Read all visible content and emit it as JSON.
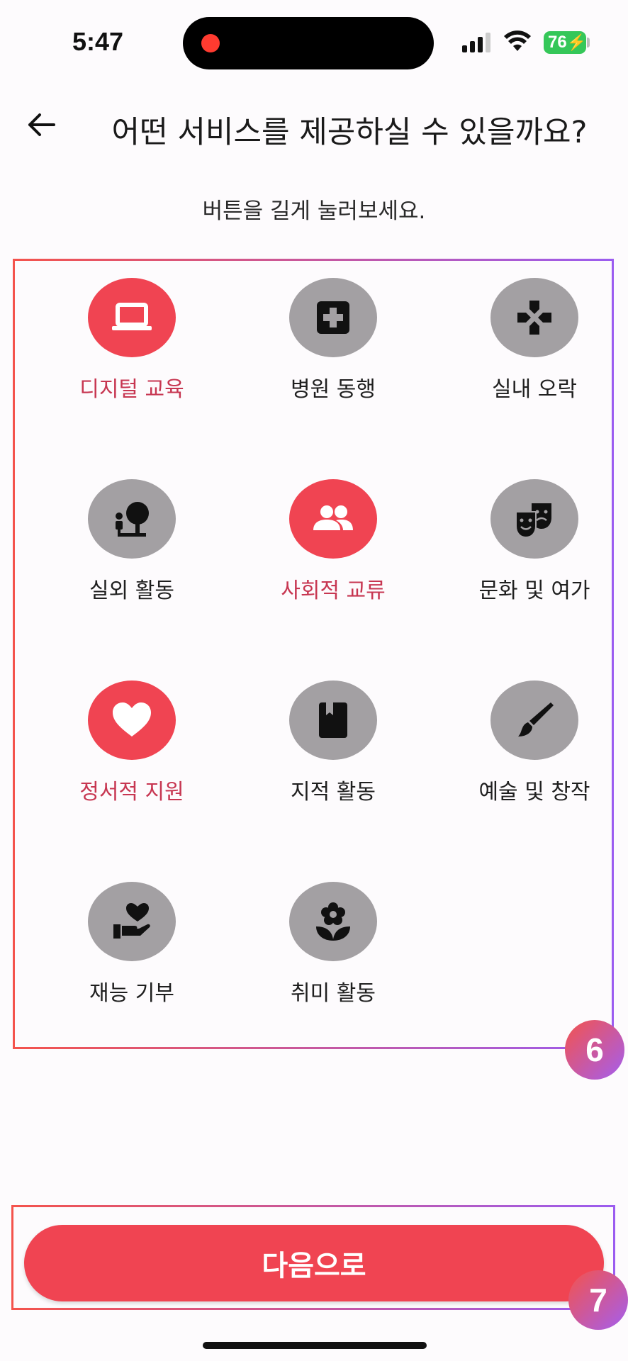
{
  "status_bar": {
    "time": "5:47",
    "battery": "76",
    "icons": [
      "recording-dot-icon",
      "cellular-signal-icon",
      "wifi-icon",
      "battery-charging-icon"
    ]
  },
  "header": {
    "back_icon": "arrow-left-icon",
    "title": "어떤 서비스를 제공하실 수 있을까요?"
  },
  "subtitle": "버튼을 길게 눌러보세요.",
  "colors": {
    "accent": "#f04452",
    "accent_text": "#c73651",
    "inactive_circle": "#a3a0a3",
    "annotation_gradient_start": "#f4534c",
    "annotation_gradient_end": "#9b5cf0"
  },
  "services": [
    {
      "label": "디지털 교육",
      "icon": "laptop-icon",
      "selected": true
    },
    {
      "label": "병원 동행",
      "icon": "medical-cross-icon",
      "selected": false
    },
    {
      "label": "실내 오락",
      "icon": "game-controller-icon",
      "selected": false
    },
    {
      "label": "실외 활동",
      "icon": "park-person-tree-icon",
      "selected": false
    },
    {
      "label": "사회적 교류",
      "icon": "people-group-icon",
      "selected": true
    },
    {
      "label": "문화 및 여가",
      "icon": "theater-masks-icon",
      "selected": false
    },
    {
      "label": "정서적 지원",
      "icon": "heart-icon",
      "selected": true
    },
    {
      "label": "지적 활동",
      "icon": "book-icon",
      "selected": false
    },
    {
      "label": "예술 및 창작",
      "icon": "paintbrush-icon",
      "selected": false
    },
    {
      "label": "재능 기부",
      "icon": "hand-heart-icon",
      "selected": false
    },
    {
      "label": "취미 활동",
      "icon": "flower-icon",
      "selected": false
    }
  ],
  "annotations": {
    "grid_badge": "6",
    "button_badge": "7"
  },
  "next_button": {
    "label": "다음으로"
  }
}
